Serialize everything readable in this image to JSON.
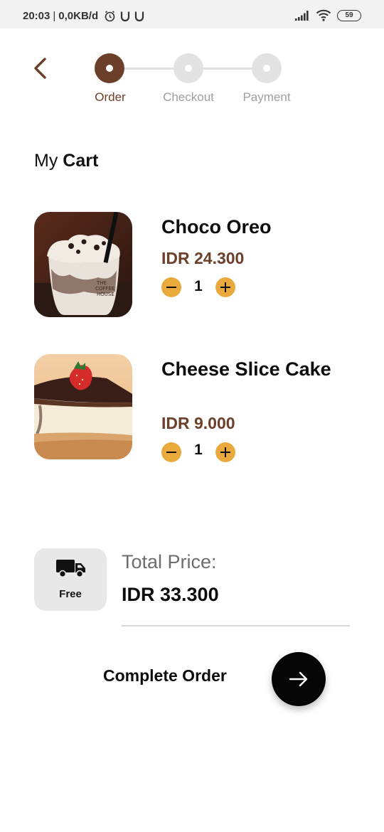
{
  "status_bar": {
    "time": "20:03",
    "network_speed": "0,0KB/d",
    "battery": "59",
    "icons": [
      "alarm-clock-icon",
      "u-notification-icon",
      "u-notification-icon",
      "signal-icon",
      "wifi-icon",
      "battery-icon"
    ]
  },
  "header": {
    "back_icon": "chevron-left-icon",
    "steps": [
      {
        "label": "Order",
        "active": true
      },
      {
        "label": "Checkout",
        "active": false
      },
      {
        "label": "Payment",
        "active": false
      }
    ]
  },
  "cart": {
    "title_prefix": "My",
    "title_bold": "Cart",
    "items": [
      {
        "name": "Choco Oreo",
        "price": "IDR 24.300",
        "quantity": "1",
        "image": "choco-oreo-drink-image"
      },
      {
        "name": "Cheese Slice Cake",
        "price": "IDR 9.000",
        "quantity": "1",
        "image": "cheesecake-slice-image"
      }
    ]
  },
  "summary": {
    "shipping_icon": "truck-icon",
    "shipping_label": "Free",
    "total_label": "Total Price:",
    "total_value": "IDR 33.300"
  },
  "footer": {
    "complete_label": "Complete Order",
    "next_icon": "arrow-right-icon"
  },
  "colors": {
    "brand_brown": "#6b3f2a",
    "accent_yellow": "#e9a93d",
    "inactive_gray": "#e2e2e2",
    "button_black": "#050505"
  }
}
